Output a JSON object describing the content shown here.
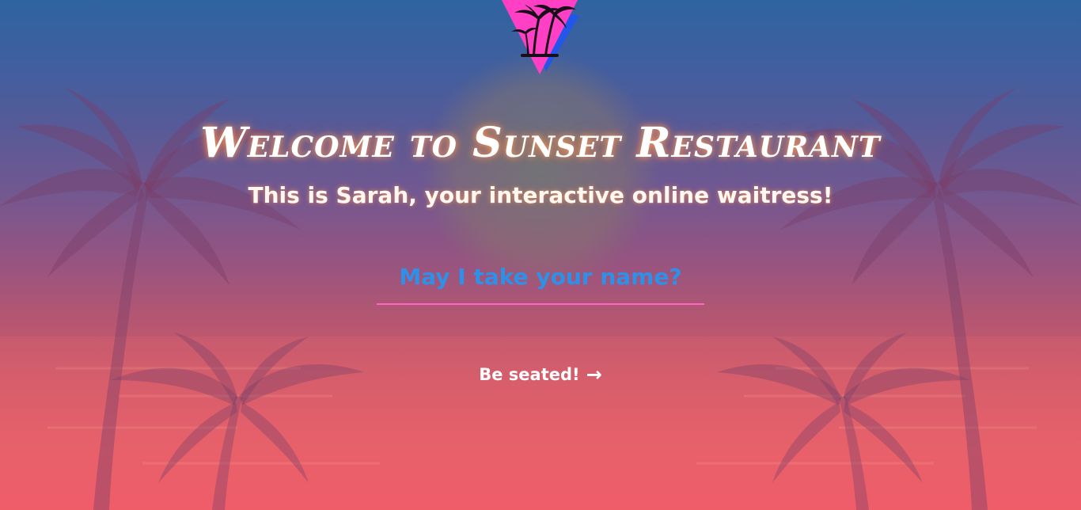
{
  "page": {
    "title": "Welcome to Sunset Restaurant",
    "subtitle": "This is Sarah, your interactive online waitress!"
  },
  "form": {
    "name_placeholder": "May I take your name?",
    "submit_label": "Be seated!",
    "submit_icon": "→"
  },
  "colors": {
    "accent_pink": "#ff66c8",
    "placeholder_blue": "#2f90e8",
    "title_glow": "#ffa05a"
  },
  "icons": {
    "logo": "palm-tree-triangle-icon",
    "submit": "arrow-right-icon"
  }
}
